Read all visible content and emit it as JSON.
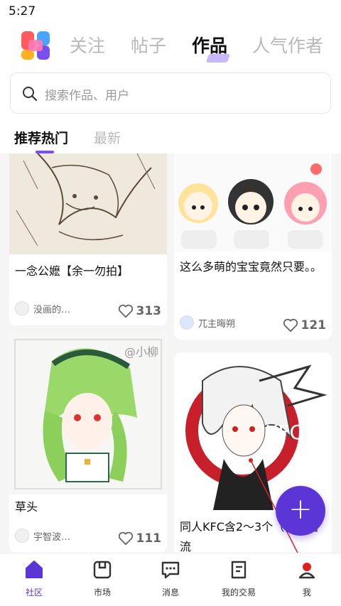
{
  "status_bar": {
    "time": "5:27"
  },
  "top_nav": {
    "tabs": [
      {
        "label": "关注",
        "active": false
      },
      {
        "label": "帖子",
        "active": false
      },
      {
        "label": "作品",
        "active": true
      },
      {
        "label": "人气作者",
        "active": false
      }
    ]
  },
  "search": {
    "placeholder": "搜索作品、用户"
  },
  "sub_tabs": [
    {
      "label": "推荐热门",
      "active": true
    },
    {
      "label": "最新",
      "active": false
    }
  ],
  "cards": [
    {
      "title": "一念公嬷【余一勿拍】",
      "user": "没画的…",
      "likes": "313"
    },
    {
      "title": "这么多萌的宝宝竟然只要。。",
      "user": "兀主晦朔",
      "likes": "121"
    },
    {
      "title": "草头",
      "user": "宇智波…",
      "likes": "111"
    },
    {
      "title": "同人KFC含2～3个（例图错流",
      "user": "",
      "likes": ""
    }
  ],
  "artwork_text": {
    "watermark": "@小柳",
    "kfc": "KFC"
  },
  "fab": {
    "icon": "plus-icon",
    "color": "#5b35d6"
  },
  "bottom_nav": [
    {
      "label": "社区",
      "icon": "home-icon",
      "active": true
    },
    {
      "label": "市场",
      "icon": "market-icon",
      "active": false
    },
    {
      "label": "消息",
      "icon": "message-icon",
      "active": false
    },
    {
      "label": "我的交易",
      "icon": "trade-icon",
      "active": false
    },
    {
      "label": "我",
      "icon": "profile-icon",
      "active": false
    }
  ],
  "colors": {
    "accent": "#5b35d6",
    "inactive_tab": "#b8b8b8",
    "annotation": "#e02020"
  }
}
